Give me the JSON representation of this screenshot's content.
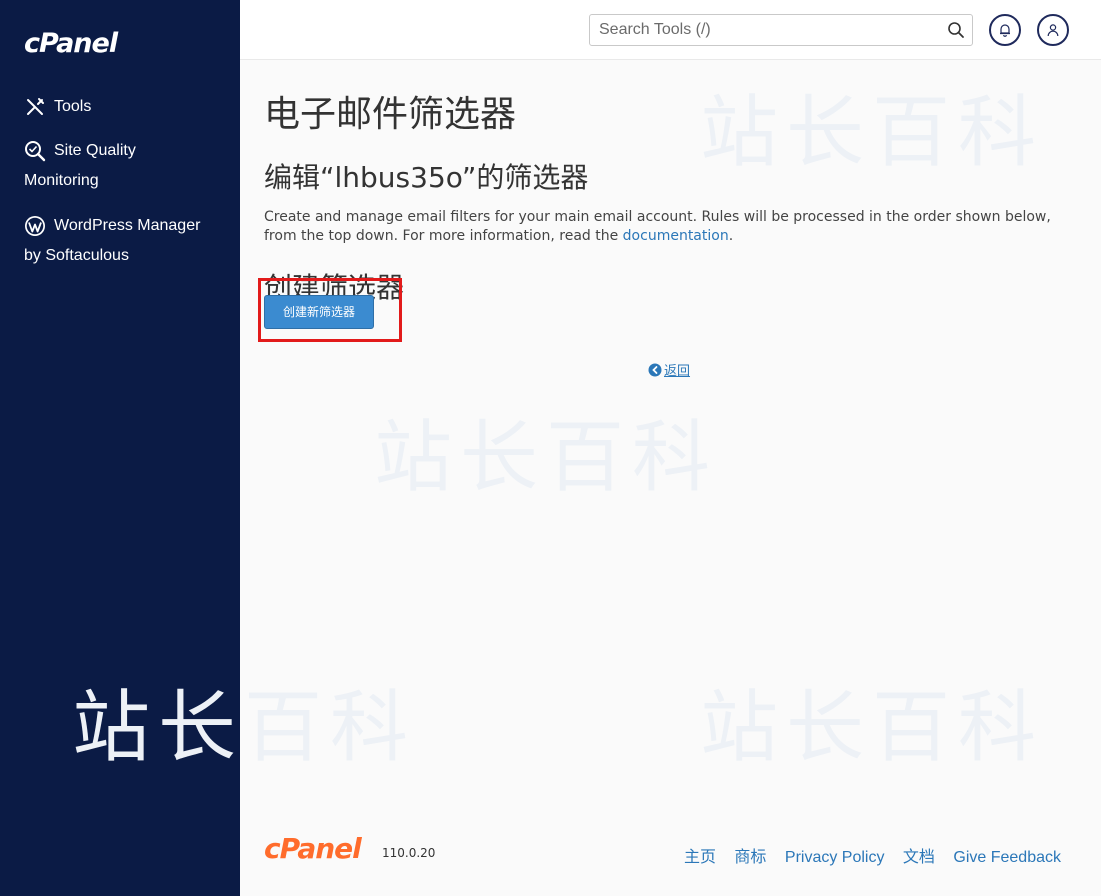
{
  "sidebar": {
    "logo": "cPanel",
    "items": [
      {
        "icon": "tools-icon",
        "label": "Tools"
      },
      {
        "icon": "site-quality-icon",
        "label": "Site Quality",
        "label2": "Monitoring"
      },
      {
        "icon": "wordpress-icon",
        "label": "WordPress Manager",
        "label2": "by Softaculous"
      }
    ]
  },
  "header": {
    "search_placeholder": "Search Tools (/)",
    "search_icon": "search-icon",
    "notifications_icon": "bell-icon",
    "user_icon": "user-icon"
  },
  "main": {
    "page_title": "电子邮件筛选器",
    "sub_title": "编辑“lhbus35o”的筛选器",
    "description": "Create and manage email filters for your main email account. Rules will be processed in the order shown below, from the top down. For more information, read the",
    "doc_link": "documentation",
    "description_end": ".",
    "section_title": "创建筛选器",
    "create_button": "创建新筛选器",
    "back_link": "返回"
  },
  "watermark": "站长百科",
  "footer": {
    "logo": "cPanel",
    "version": "110.0.20",
    "links": [
      "主页",
      "商标",
      "Privacy Policy",
      "文档",
      "Give Feedback"
    ]
  },
  "colors": {
    "sidebar_bg": "#0b1b45",
    "accent": "#3b8bd0",
    "link": "#2b77b8",
    "brand_orange": "#ff6c2c",
    "highlight_red": "#e21a1a"
  }
}
